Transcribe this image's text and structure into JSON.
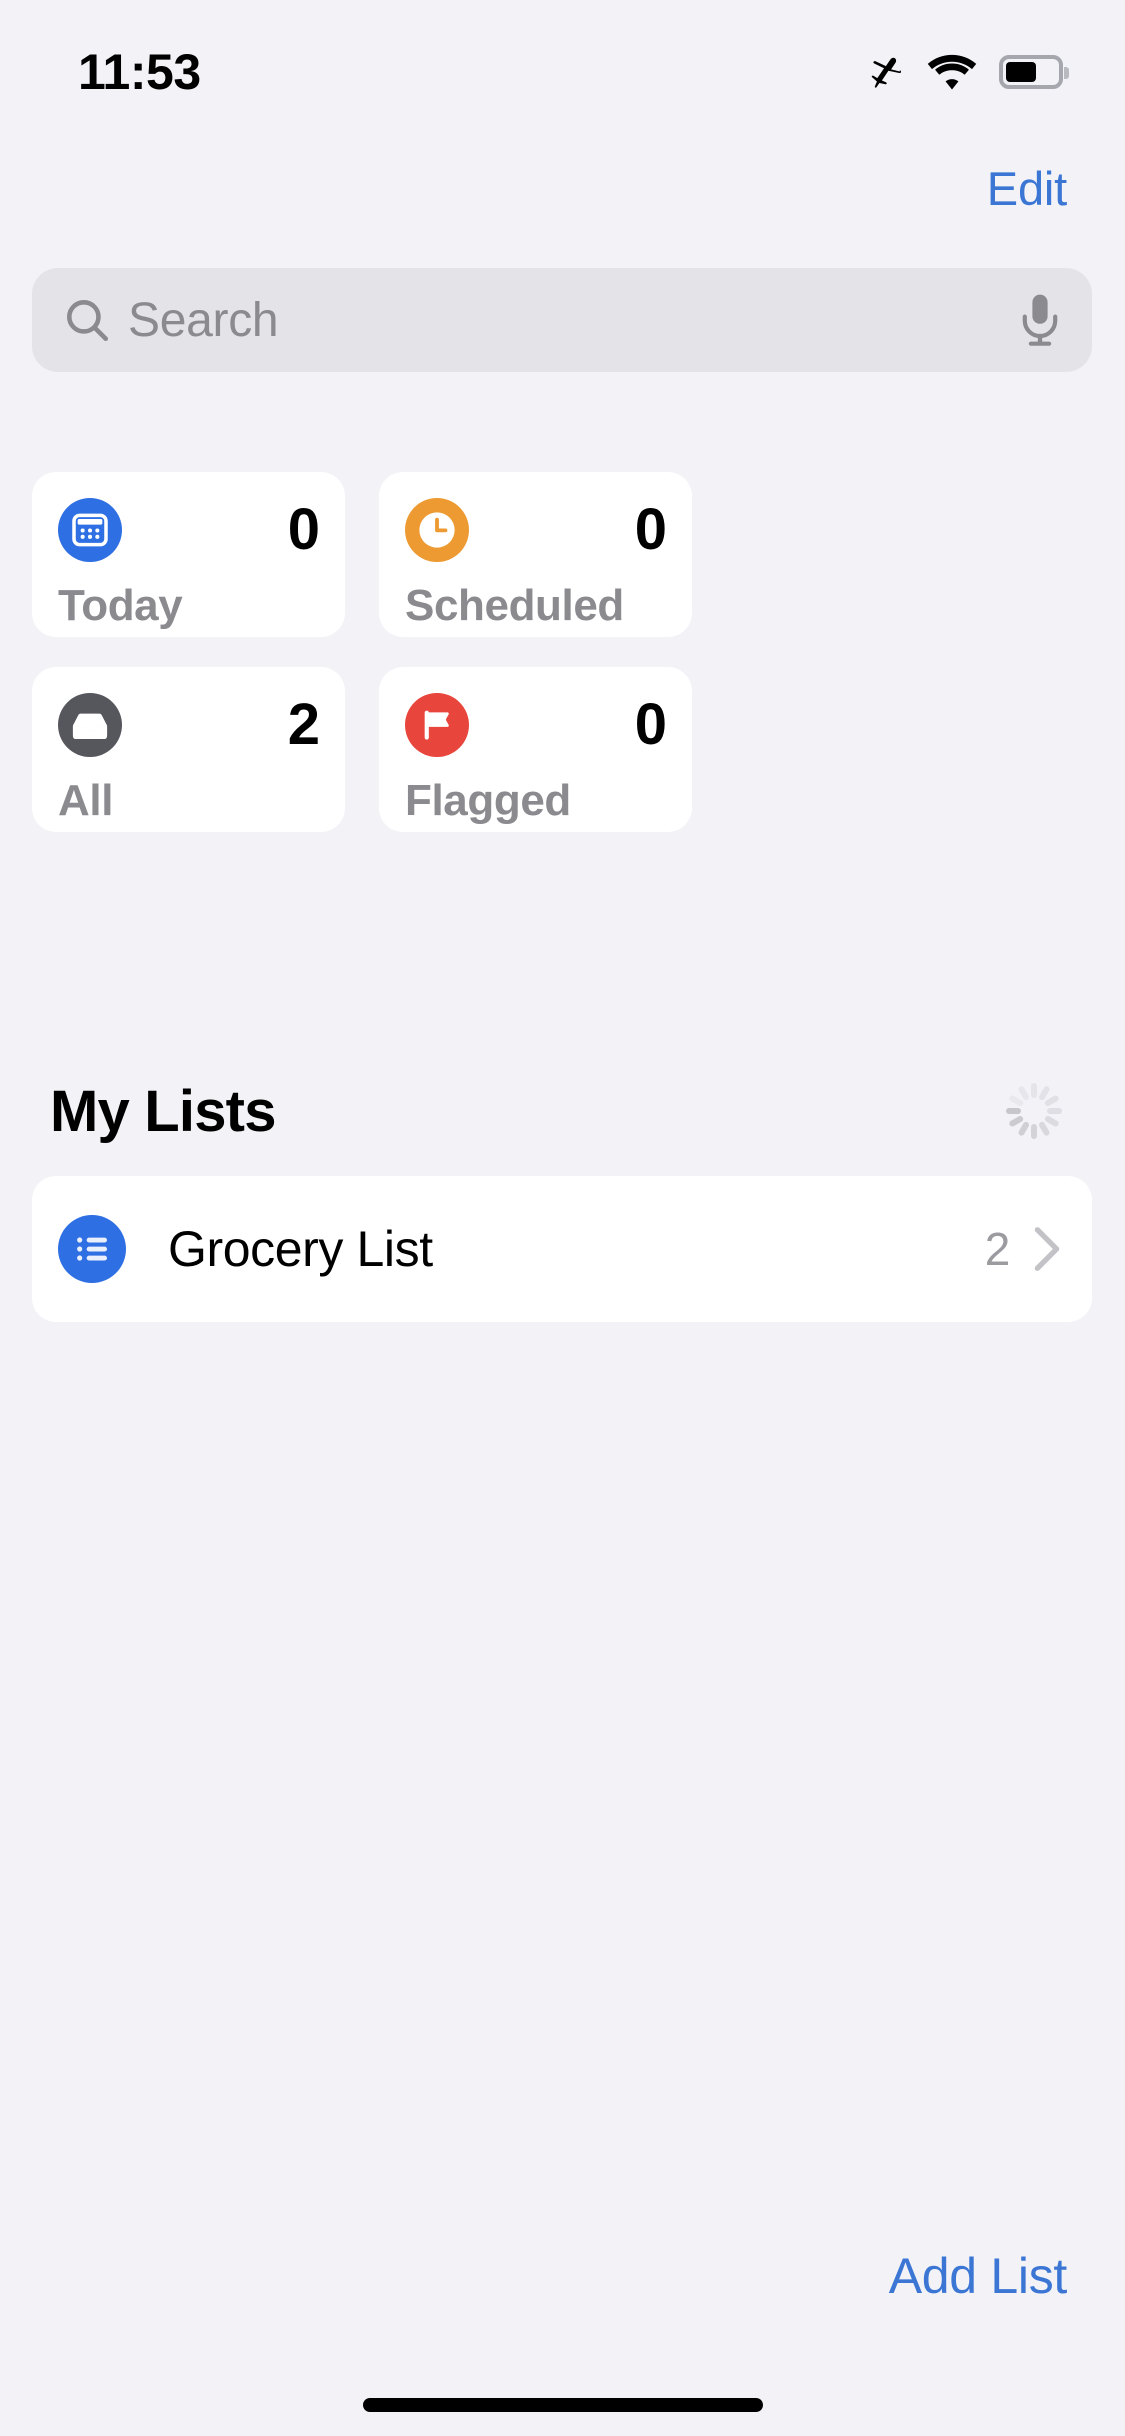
{
  "status_bar": {
    "time": "11:53",
    "icons": [
      "airplane-mode-icon",
      "wifi-icon",
      "battery-icon"
    ],
    "battery_level_percent": 55
  },
  "navigation": {
    "edit_label": "Edit"
  },
  "search": {
    "placeholder": "Search",
    "value": "",
    "leading_icon": "search-icon",
    "trailing_icon": "microphone-icon"
  },
  "smart_lists": [
    {
      "id": "today",
      "label": "Today",
      "count": "0",
      "icon": "calendar-icon",
      "color": "#2F6FE4"
    },
    {
      "id": "scheduled",
      "label": "Scheduled",
      "count": "0",
      "icon": "clock-icon",
      "color": "#EC9A31"
    },
    {
      "id": "all",
      "label": "All",
      "count": "2",
      "icon": "inbox-icon",
      "color": "#56575D"
    },
    {
      "id": "flagged",
      "label": "Flagged",
      "count": "0",
      "icon": "flag-icon",
      "color": "#E8453C"
    }
  ],
  "my_lists_section": {
    "title": "My Lists",
    "status_indicator": "loading-spinner-icon",
    "lists": [
      {
        "name": "Grocery List",
        "count": "2",
        "icon": "bulleted-list-icon",
        "color": "#2F6FE4",
        "accessory": "chevron-right-icon"
      }
    ]
  },
  "footer": {
    "add_list_label": "Add List"
  },
  "theme": {
    "background": "#F2F2F7",
    "card_background": "#FFFFFF",
    "accent_blue": "#3B76D4",
    "secondary_text": "#8A8A8F",
    "search_field": "#E3E3E8"
  }
}
